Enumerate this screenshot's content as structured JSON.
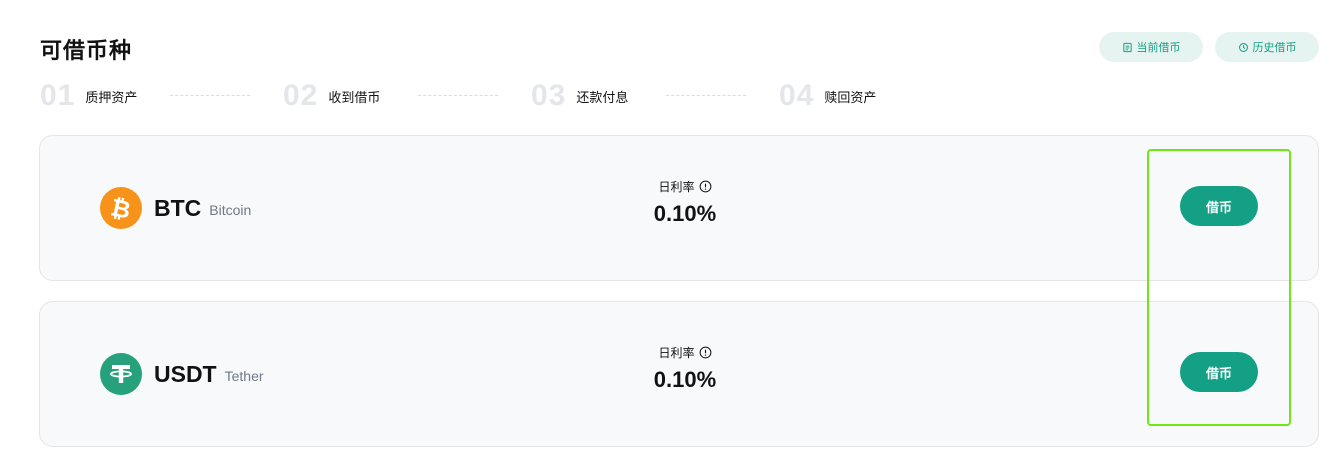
{
  "page": {
    "title": "可借币种"
  },
  "header_actions": {
    "current_loans": "当前借币",
    "history_loans": "历史借币"
  },
  "steps": [
    {
      "num": "01",
      "label": "质押资产"
    },
    {
      "num": "02",
      "label": "收到借币"
    },
    {
      "num": "03",
      "label": "还款付息"
    },
    {
      "num": "04",
      "label": "赎回资产"
    }
  ],
  "coins": [
    {
      "symbol": "BTC",
      "name": "Bitcoin",
      "rate_label": "日利率",
      "rate": "0.10%",
      "action": "借币",
      "icon": "bitcoin-icon",
      "color": "#f7931a"
    },
    {
      "symbol": "USDT",
      "name": "Tether",
      "rate_label": "日利率",
      "rate": "0.10%",
      "action": "借币",
      "icon": "tether-icon",
      "color": "#26a17b"
    }
  ],
  "colors": {
    "accent": "#14a085",
    "accent_light": "#e6f4f1",
    "highlight": "#6ee619"
  }
}
